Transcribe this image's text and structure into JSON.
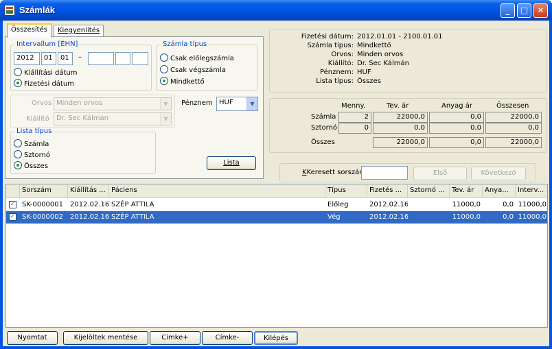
{
  "window": {
    "title": "Számlák"
  },
  "tabs": [
    {
      "label": "Összesítés"
    },
    {
      "label": "Kiegyenlítés"
    }
  ],
  "interval": {
    "legend": "Intervallum [ÉHN]",
    "from": {
      "year": "2012",
      "month": "01",
      "day": "01"
    },
    "separator": "–",
    "to": {
      "year": "",
      "month": "",
      "day": ""
    },
    "radio_issue": "Kiállítási dátum",
    "radio_payment": "Fizetési dátum"
  },
  "invoice_type": {
    "legend": "Számla típus",
    "options": [
      "Csak előlegszámla",
      "Csak végszámla",
      "Mindkettő"
    ]
  },
  "filters": {
    "doctor_label": "Orvos",
    "doctor_value": "Minden orvos",
    "issuer_label": "Kiállító",
    "issuer_value": "Dr. Sec Kálmán",
    "currency_label": "Pénznem",
    "currency_value": "HUF"
  },
  "list_type": {
    "legend": "Lista típus",
    "options": [
      "Számla",
      "Sztornó",
      "Összes"
    ]
  },
  "buttons": {
    "list": "Lista",
    "first": "Első",
    "next": "Következő",
    "print": "Nyomtat",
    "save_selected": "Kijelöltek mentése",
    "label_plus": "Címke+",
    "label_minus": "Címke-",
    "exit": "Kilépés"
  },
  "summary": [
    {
      "key": "Fizetési dátum:",
      "value": "2012.01.01 - 2100.01.01"
    },
    {
      "key": "Számla típus:",
      "value": "Mindkettő"
    },
    {
      "key": "Orvos:",
      "value": "Minden orvos"
    },
    {
      "key": "Kiállító:",
      "value": "Dr. Sec Kálmán"
    },
    {
      "key": "Pénznem:",
      "value": "HUF"
    },
    {
      "key": "Lista típus:",
      "value": "Összes"
    }
  ],
  "totals": {
    "headers": [
      "Menny.",
      "Tev. ár",
      "Anyag ár",
      "Összesen"
    ],
    "rows": [
      {
        "label": "Számla",
        "values": [
          "2",
          "22000,0",
          "0,0",
          "22000,0"
        ]
      },
      {
        "label": "Sztornó",
        "values": [
          "0",
          "0,0",
          "0,0",
          "0,0"
        ]
      },
      {
        "label": "Összes",
        "values": [
          "",
          "22000,0",
          "0,0",
          "22000,0"
        ]
      }
    ]
  },
  "search": {
    "label": "Keresett sorszám",
    "value": ""
  },
  "grid": {
    "columns": [
      "Sorszám",
      "Kiállítás ...",
      "Páciens",
      "Típus",
      "Fizetés ...",
      "Sztornó ...",
      "Tev. ár",
      "Anya...",
      "Interv..."
    ],
    "rows": [
      {
        "checked": true,
        "cells": [
          "SK-0000001",
          "2012.02.16",
          "SZÉP ATTILA",
          "Előleg",
          "2012.02.16",
          "",
          "11000,0",
          "0,0",
          "11000,0"
        ]
      },
      {
        "checked": true,
        "cells": [
          "SK-0000002",
          "2012.02.16",
          "SZÉP ATTILA",
          "Vég",
          "2012.02.16",
          "",
          "11000,0",
          "0,0",
          "11000,0"
        ]
      }
    ]
  }
}
